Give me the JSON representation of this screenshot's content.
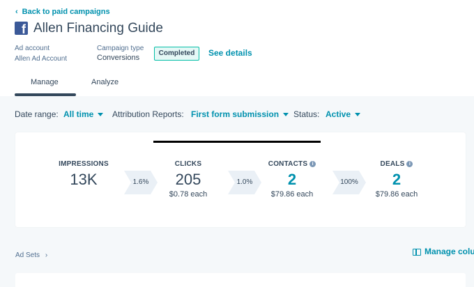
{
  "header": {
    "back_label": "Back to paid campaigns",
    "title": "Allen Financing Guide",
    "ad_account_label": "Ad account",
    "ad_account_value": "Allen Ad Account",
    "campaign_type_label": "Campaign type",
    "campaign_type_value": "Conversions",
    "status_badge": "Completed",
    "see_details": "See details"
  },
  "tabs": [
    {
      "label": "Manage",
      "active": true
    },
    {
      "label": "Analyze",
      "active": false
    }
  ],
  "filters": {
    "date_range_label": "Date range:",
    "date_range_value": "All time",
    "attribution_label": "Attribution Reports:",
    "attribution_value": "First form submission",
    "status_label": "Status:",
    "status_value": "Active"
  },
  "funnel": {
    "stats": [
      {
        "label": "IMPRESSIONS",
        "value": "13K",
        "sub": ""
      },
      {
        "label": "CLICKS",
        "value": "205",
        "sub": "$0.78 each"
      },
      {
        "label": "CONTACTS",
        "value": "2",
        "sub": "$79.86 each"
      },
      {
        "label": "DEALS",
        "value": "2",
        "sub": "$79.86 each"
      }
    ],
    "rates": [
      "1.6%",
      "1.0%",
      "100%"
    ]
  },
  "ad_sets_label": "Ad Sets",
  "ad_sets_chevron": "›",
  "manage_columns": "Manage colu",
  "colors": {
    "accent": "#0091ae",
    "brand_facebook": "#3b5998",
    "badge_border": "#00bda5",
    "text": "#33475b"
  },
  "icons": {
    "back": "chevron-left-icon",
    "facebook": "facebook-icon",
    "info": "info-icon",
    "columns": "columns-icon",
    "caret": "caret-down-icon"
  }
}
